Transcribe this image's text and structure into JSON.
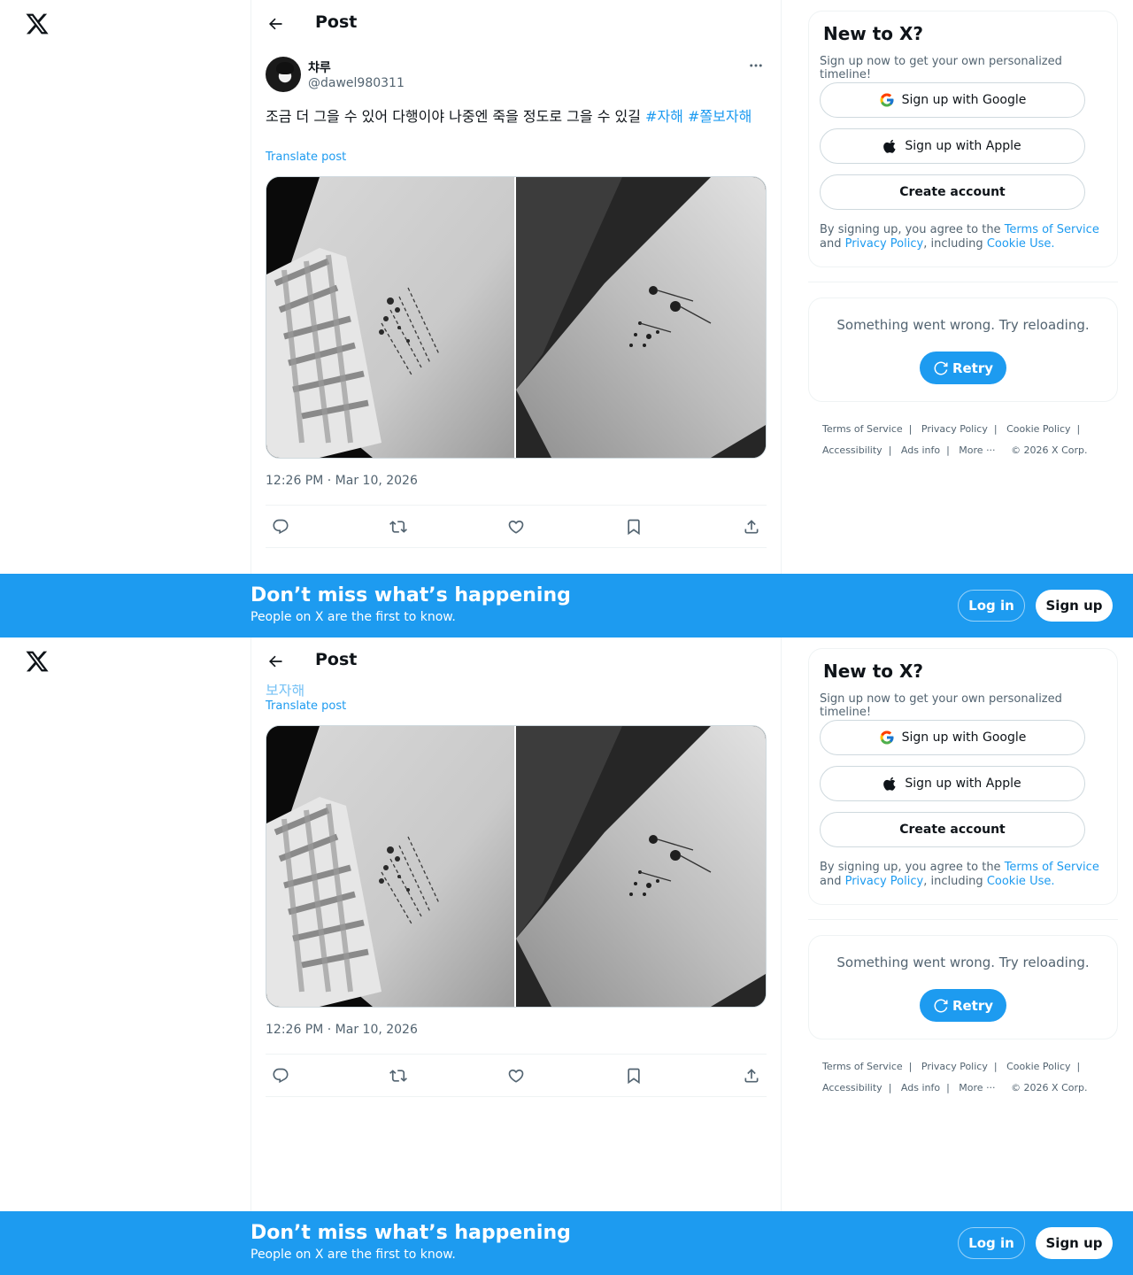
{
  "header": {
    "title": "Post"
  },
  "post": {
    "display_name": "챠루",
    "handle": "@dawel980311",
    "more": "···",
    "text_plain": "조금 더 그을 수 있어 다행이야 나중엔 죽을 정도로 그을 수 있길 ",
    "hashtag_1": "#자해",
    "hashtag_2": "#쫄보자해",
    "hashtag_2_tail": "보자해",
    "translate": "Translate post",
    "timestamp": "12:26 PM · Mar 10, 2026"
  },
  "sidebar": {
    "title": "New to X?",
    "subtitle": "Sign up now to get your own personalized timeline!",
    "google": "Sign up with Google",
    "apple": "Sign up with Apple",
    "create": "Create account",
    "terms_prefix": "By signing up, you agree to the ",
    "terms_link": "Terms of Service",
    "terms_and": " and ",
    "privacy_link": "Privacy Policy",
    "including": ", including ",
    "cookie_link": "Cookie Use.",
    "error_text": "Something went wrong. Try reloading.",
    "retry": "Retry"
  },
  "footer": {
    "terms": "Terms of Service",
    "privacy": "Privacy Policy",
    "cookie": "Cookie Policy",
    "accessibility": "Accessibility",
    "ads": "Ads info",
    "more": "More ···",
    "copyright": "© 2026 X Corp."
  },
  "banner": {
    "title": "Don’t miss what’s happening",
    "subtitle": "People on X are the first to know.",
    "login": "Log in",
    "signup": "Sign up"
  },
  "icons": {
    "logo": "x-logo-icon",
    "back": "arrow-left-icon",
    "reply": "reply-icon",
    "repost": "repost-icon",
    "like": "heart-icon",
    "bookmark": "bookmark-icon",
    "share": "share-icon"
  },
  "colors": {
    "accent": "#1d9bf0",
    "text": "#0f1419",
    "muted": "#536471",
    "border": "#eff3f4"
  }
}
